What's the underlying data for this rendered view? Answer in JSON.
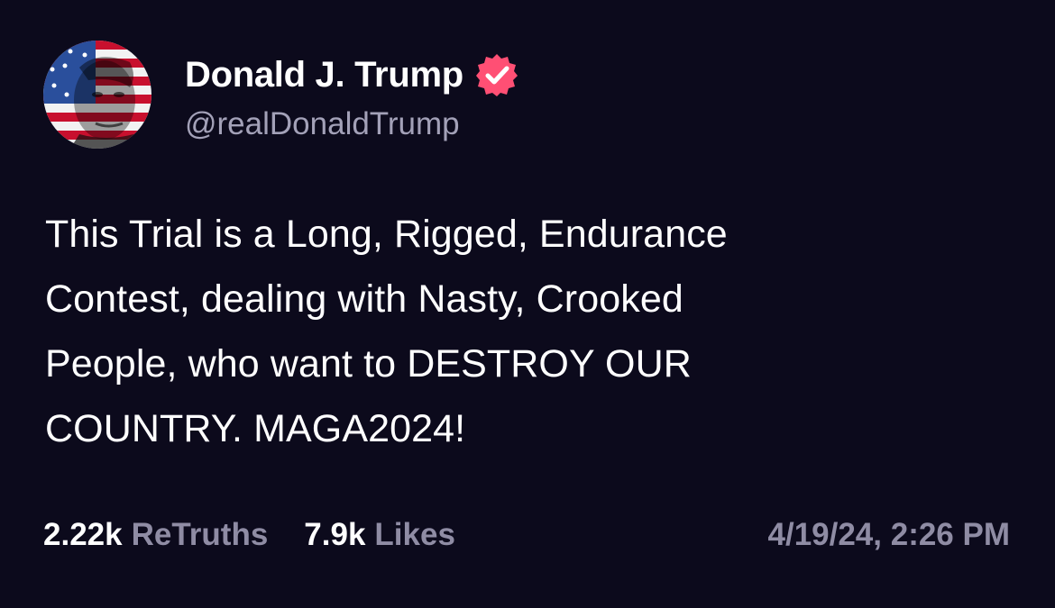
{
  "author": {
    "name": "Donald J. Trump",
    "handle": "@realDonaldTrump",
    "verified": true
  },
  "post": {
    "text": "This Trial is a Long, Rigged, Endurance\nContest, dealing with Nasty, Crooked\nPeople, who want to DESTROY OUR\nCOUNTRY. MAGA2024!"
  },
  "stats": {
    "retruths_count": "2.22k",
    "retruths_label": "ReTruths",
    "likes_count": "7.9k",
    "likes_label": "Likes"
  },
  "timestamp": "4/19/24, 2:26 PM",
  "colors": {
    "background": "#0c0a1c",
    "verified_badge": "#ff4f74",
    "muted_text": "#8f8ca4"
  },
  "icons": {
    "verified": "verified-badge-icon",
    "avatar": "flag-portrait-avatar"
  }
}
